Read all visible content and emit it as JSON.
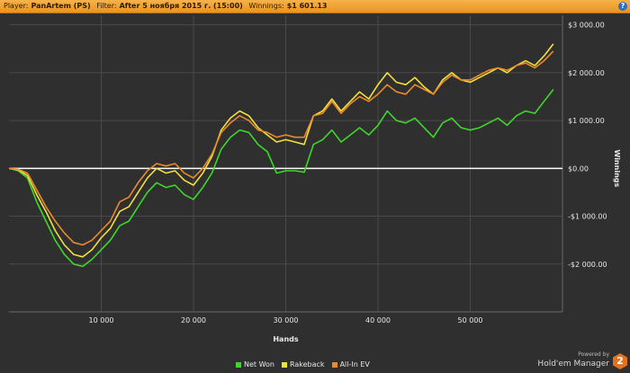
{
  "header": {
    "player_label": "Player:",
    "player_value": "PanArtem (PS)",
    "filter_label": "Filter:",
    "filter_value": "After 5 ноября 2015 г. (15:00)",
    "winnings_label": "Winnings:",
    "winnings_value": "$1 601.13",
    "help_icon": "question-icon"
  },
  "brand": {
    "powered_by": "Powered by",
    "name": "Hold'em Manager",
    "logo_text": "2"
  },
  "chart_data": {
    "type": "line",
    "xlabel": "Hands",
    "ylabel": "Winnings",
    "xlim": [
      0,
      60000
    ],
    "ylim": [
      -3000,
      3200
    ],
    "x_ticks": [
      10000,
      20000,
      30000,
      40000,
      50000
    ],
    "x_tick_labels": [
      "10 000",
      "20 000",
      "30 000",
      "40 000",
      "50 000"
    ],
    "y_ticks": [
      -2000,
      -1000,
      0,
      1000,
      2000,
      3000
    ],
    "y_tick_labels": [
      "-$2 000.00",
      "-$1 000.00",
      "$0.00",
      "$1 000.00",
      "$2 000.00",
      "$3 000.00"
    ],
    "grid": true,
    "legend_position": "bottom",
    "colors": {
      "background": "#2f2f2f",
      "grid": "#4a4a4a",
      "zero_line": "#ffffff"
    },
    "series": [
      {
        "name": "Net Won",
        "color": "#3ed82a",
        "x": [
          0,
          1000,
          2000,
          3000,
          4000,
          5000,
          6000,
          7000,
          8000,
          9000,
          10000,
          11000,
          12000,
          13000,
          14000,
          15000,
          16000,
          17000,
          18000,
          19000,
          20000,
          21000,
          22000,
          23000,
          24000,
          25000,
          26000,
          27000,
          28000,
          29000,
          30000,
          31000,
          32000,
          33000,
          34000,
          35000,
          36000,
          37000,
          38000,
          39000,
          40000,
          41000,
          42000,
          43000,
          44000,
          45000,
          46000,
          47000,
          48000,
          49000,
          50000,
          51000,
          52000,
          53000,
          54000,
          55000,
          56000,
          57000,
          58000,
          59000
        ],
        "values": [
          0,
          -50,
          -200,
          -700,
          -1100,
          -1500,
          -1800,
          -2000,
          -2050,
          -1900,
          -1700,
          -1500,
          -1200,
          -1100,
          -800,
          -500,
          -300,
          -400,
          -350,
          -550,
          -650,
          -400,
          -100,
          400,
          650,
          800,
          750,
          500,
          350,
          -100,
          -50,
          -50,
          -80,
          500,
          600,
          800,
          550,
          700,
          850,
          700,
          900,
          1200,
          1000,
          950,
          1050,
          850,
          650,
          950,
          1050,
          850,
          800,
          850,
          950,
          1050,
          900,
          1100,
          1200,
          1150,
          1400,
          1650
        ]
      },
      {
        "name": "Rakeback",
        "color": "#f2e03c",
        "x": [
          0,
          1000,
          2000,
          3000,
          4000,
          5000,
          6000,
          7000,
          8000,
          9000,
          10000,
          11000,
          12000,
          13000,
          14000,
          15000,
          16000,
          17000,
          18000,
          19000,
          20000,
          21000,
          22000,
          23000,
          24000,
          25000,
          26000,
          27000,
          28000,
          29000,
          30000,
          31000,
          32000,
          33000,
          34000,
          35000,
          36000,
          37000,
          38000,
          39000,
          40000,
          41000,
          42000,
          43000,
          44000,
          45000,
          46000,
          47000,
          48000,
          49000,
          50000,
          51000,
          52000,
          53000,
          54000,
          55000,
          56000,
          57000,
          58000,
          59000
        ],
        "values": [
          0,
          -30,
          -150,
          -550,
          -900,
          -1300,
          -1600,
          -1800,
          -1850,
          -1700,
          -1450,
          -1250,
          -900,
          -800,
          -500,
          -200,
          0,
          -100,
          -50,
          -250,
          -350,
          -100,
          250,
          800,
          1050,
          1200,
          1100,
          850,
          700,
          550,
          600,
          550,
          500,
          1100,
          1200,
          1450,
          1200,
          1400,
          1600,
          1450,
          1750,
          2000,
          1800,
          1750,
          1900,
          1700,
          1550,
          1850,
          2000,
          1850,
          1800,
          1900,
          2000,
          2100,
          2000,
          2150,
          2250,
          2150,
          2350,
          2600
        ]
      },
      {
        "name": "All-In EV",
        "color": "#ea8a2c",
        "x": [
          0,
          1000,
          2000,
          3000,
          4000,
          5000,
          6000,
          7000,
          8000,
          9000,
          10000,
          11000,
          12000,
          13000,
          14000,
          15000,
          16000,
          17000,
          18000,
          19000,
          20000,
          21000,
          22000,
          23000,
          24000,
          25000,
          26000,
          27000,
          28000,
          29000,
          30000,
          31000,
          32000,
          33000,
          34000,
          35000,
          36000,
          37000,
          38000,
          39000,
          40000,
          41000,
          42000,
          43000,
          44000,
          45000,
          46000,
          47000,
          48000,
          49000,
          50000,
          51000,
          52000,
          53000,
          54000,
          55000,
          56000,
          57000,
          58000,
          59000
        ],
        "values": [
          0,
          -20,
          -100,
          -450,
          -800,
          -1100,
          -1350,
          -1550,
          -1600,
          -1500,
          -1300,
          -1100,
          -700,
          -600,
          -300,
          -50,
          100,
          50,
          100,
          -100,
          -200,
          0,
          300,
          750,
          950,
          1100,
          1000,
          800,
          750,
          650,
          700,
          650,
          650,
          1100,
          1150,
          1400,
          1150,
          1350,
          1500,
          1400,
          1550,
          1750,
          1600,
          1550,
          1750,
          1650,
          1550,
          1800,
          1950,
          1850,
          1850,
          1950,
          2050,
          2100,
          2050,
          2150,
          2200,
          2100,
          2250,
          2450
        ]
      }
    ]
  }
}
